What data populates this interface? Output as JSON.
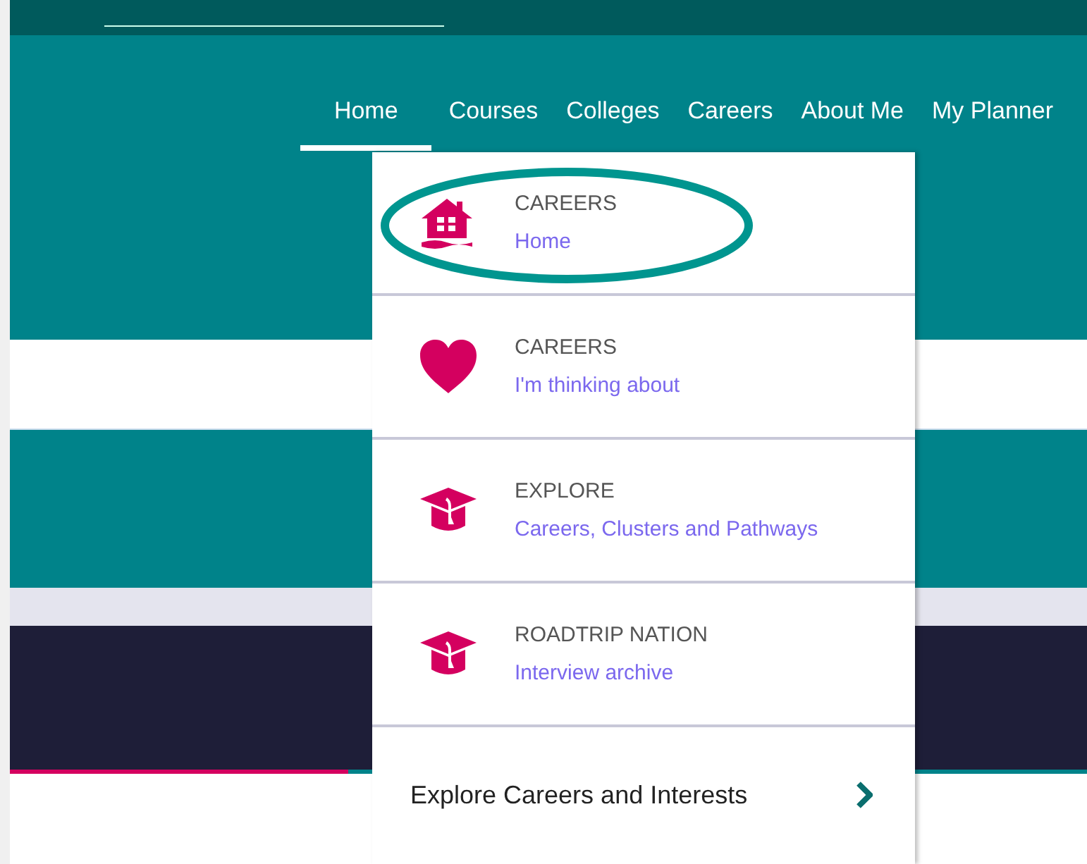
{
  "nav": [
    {
      "label": "Home",
      "selected": true
    },
    {
      "label": "Courses",
      "selected": false
    },
    {
      "label": "Colleges",
      "selected": false
    },
    {
      "label": "Careers",
      "selected": false
    },
    {
      "label": "About Me",
      "selected": false
    },
    {
      "label": "My Planner",
      "selected": false
    }
  ],
  "menu": {
    "items": [
      {
        "kind": "house",
        "title": "CAREERS",
        "link": "Home",
        "circled": true
      },
      {
        "kind": "heart",
        "title": "CAREERS",
        "link": "I'm thinking about",
        "circled": false
      },
      {
        "kind": "cap",
        "title": "EXPLORE",
        "link": "Careers, Clusters and Pathways",
        "circled": false
      },
      {
        "kind": "cap",
        "title": "ROADTRIP NATION",
        "link": "Interview archive",
        "circled": false
      }
    ],
    "footer": {
      "label": "Explore Careers and Interests"
    }
  }
}
